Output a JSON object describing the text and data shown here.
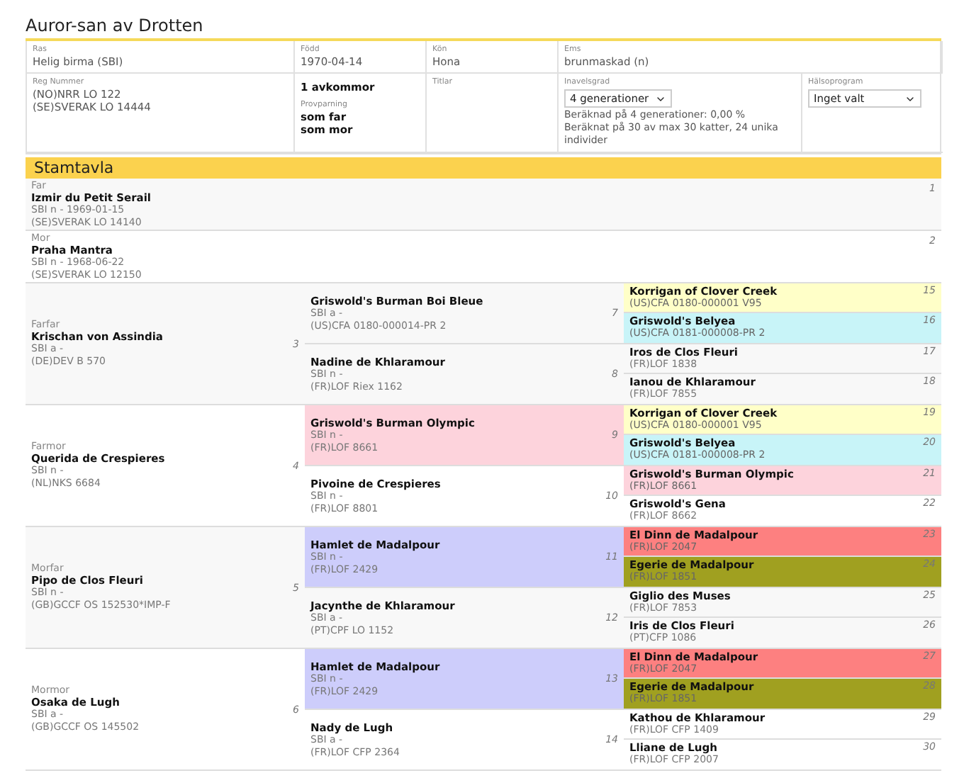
{
  "title": "Auror-san av Drotten",
  "info": {
    "breed": {
      "label": "Ras",
      "value": "Helig birma (SBI)"
    },
    "born": {
      "label": "Född",
      "value": "1970-04-14"
    },
    "sex": {
      "label": "Kön",
      "value": "Hona"
    },
    "ems": {
      "label": "Ems",
      "value": "brunmaskad (n)"
    },
    "reg": {
      "label": "Reg Nummer",
      "lines": [
        "(NO)NRR LO 122",
        "(SE)SVERAK LO 14444"
      ]
    },
    "offspring": "1 avkommor",
    "test_mating": {
      "label": "Provparning",
      "links": [
        "som far",
        "som mor"
      ]
    },
    "titles": {
      "label": "Titlar"
    },
    "inbreeding": {
      "label": "Inavelsgrad",
      "select": "4 generationer",
      "lines": [
        "Beräknad på 4 generationer: 0,00 %",
        "Beräknat på 30 av max 30 katter, 24 unika individer"
      ]
    },
    "health": {
      "label": "Hälsoprogram",
      "select": "Inget valt"
    }
  },
  "section_title": "Stamtavla",
  "parents": [
    {
      "label": "Far",
      "name": "Izmir du Petit Serail",
      "lines": [
        "SBI n - 1969-01-15",
        "(SE)SVERAK LO 14140"
      ],
      "number": "1"
    },
    {
      "label": "Mor",
      "name": "Praha Mantra",
      "lines": [
        "SBI n - 1968-06-22",
        "(SE)SVERAK LO 12150"
      ],
      "number": "2"
    }
  ],
  "grandparents": [
    {
      "label": "Farfar",
      "name": "Krischan von Assindia",
      "lines": [
        "SBI a -",
        "(DE)DEV B 570"
      ],
      "number": "3",
      "children": [
        {
          "name": "Griswold's Burman Boi Bleue",
          "lines": [
            "SBI a -",
            "(US)CFA 0180-000014-PR 2"
          ],
          "number": "7",
          "children": [
            {
              "name": "Korrigan of Clover Creek",
              "reg": "(US)CFA 0180-000001 V95",
              "number": "15",
              "color": "#ffffc8"
            },
            {
              "name": "Griswold's Belyea",
              "reg": "(US)CFA 0181-000008-PR 2",
              "number": "16",
              "color": "#c8f4f8"
            }
          ]
        },
        {
          "name": "Nadine de Khlaramour",
          "lines": [
            "SBI n -",
            "(FR)LOF Riex 1162"
          ],
          "number": "8",
          "children": [
            {
              "name": "Iros de Clos Fleuri",
              "reg": "(FR)LOF 1838",
              "number": "17"
            },
            {
              "name": "Ianou de Khlaramour",
              "reg": "(FR)LOF 7855",
              "number": "18"
            }
          ]
        }
      ]
    },
    {
      "label": "Farmor",
      "name": "Querida de Crespieres",
      "lines": [
        "SBI n -",
        "(NL)NKS 6684"
      ],
      "number": "4",
      "children": [
        {
          "name": "Griswold's Burman Olympic",
          "lines": [
            "SBI n -",
            "(FR)LOF 8661"
          ],
          "number": "9",
          "color": "#fdd3dc",
          "children": [
            {
              "name": "Korrigan of Clover Creek",
              "reg": "(US)CFA 0180-000001 V95",
              "number": "19",
              "color": "#ffffc8"
            },
            {
              "name": "Griswold's Belyea",
              "reg": "(US)CFA 0181-000008-PR 2",
              "number": "20",
              "color": "#c8f4f8"
            }
          ]
        },
        {
          "name": "Pivoine de Crespieres",
          "lines": [
            "SBI n -",
            "(FR)LOF 8801"
          ],
          "number": "10",
          "children": [
            {
              "name": "Griswold's Burman Olympic",
              "reg": "(FR)LOF 8661",
              "number": "21",
              "color": "#fdd3dc"
            },
            {
              "name": "Griswold's Gena",
              "reg": "(FR)LOF 8662",
              "number": "22"
            }
          ]
        }
      ]
    },
    {
      "label": "Morfar",
      "name": "Pipo de Clos Fleuri",
      "lines": [
        "SBI n -",
        "(GB)GCCF OS 152530*IMP-F"
      ],
      "number": "5",
      "children": [
        {
          "name": "Hamlet de Madalpour",
          "lines": [
            "SBI n -",
            "(FR)LOF 2429"
          ],
          "number": "11",
          "color": "#cdcdfb",
          "children": [
            {
              "name": "El Dinn de Madalpour",
              "reg": "(FR)LOF 2047",
              "number": "23",
              "color": "#fd8080"
            },
            {
              "name": "Egerie de Madalpour",
              "reg": "(FR)LOF 1851",
              "number": "24",
              "color": "#a0a020"
            }
          ]
        },
        {
          "name": "Jacynthe de Khlaramour",
          "lines": [
            "SBI a -",
            "(PT)CPF LO 1152"
          ],
          "number": "12",
          "children": [
            {
              "name": "Giglio des Muses",
              "reg": "(FR)LOF 7853",
              "number": "25"
            },
            {
              "name": "Iris de Clos Fleuri",
              "reg": "(PT)CFP 1086",
              "number": "26"
            }
          ]
        }
      ]
    },
    {
      "label": "Mormor",
      "name": "Osaka de Lugh",
      "lines": [
        "SBI a -",
        "(GB)GCCF OS 145502"
      ],
      "number": "6",
      "children": [
        {
          "name": "Hamlet de Madalpour",
          "lines": [
            "SBI n -",
            "(FR)LOF 2429"
          ],
          "number": "13",
          "color": "#cdcdfb",
          "children": [
            {
              "name": "El Dinn de Madalpour",
              "reg": "(FR)LOF 2047",
              "number": "27",
              "color": "#fd8080"
            },
            {
              "name": "Egerie de Madalpour",
              "reg": "(FR)LOF 1851",
              "number": "28",
              "color": "#a0a020"
            }
          ]
        },
        {
          "name": "Nady de Lugh",
          "lines": [
            "SBI a -",
            "(FR)LOF CFP 2364"
          ],
          "number": "14",
          "children": [
            {
              "name": "Kathou de Khlaramour",
              "reg": "(FR)LOF CFP 1409",
              "number": "29"
            },
            {
              "name": "Lliane de Lugh",
              "reg": "(FR)LOF CFP 2007",
              "number": "30"
            }
          ]
        }
      ]
    }
  ]
}
